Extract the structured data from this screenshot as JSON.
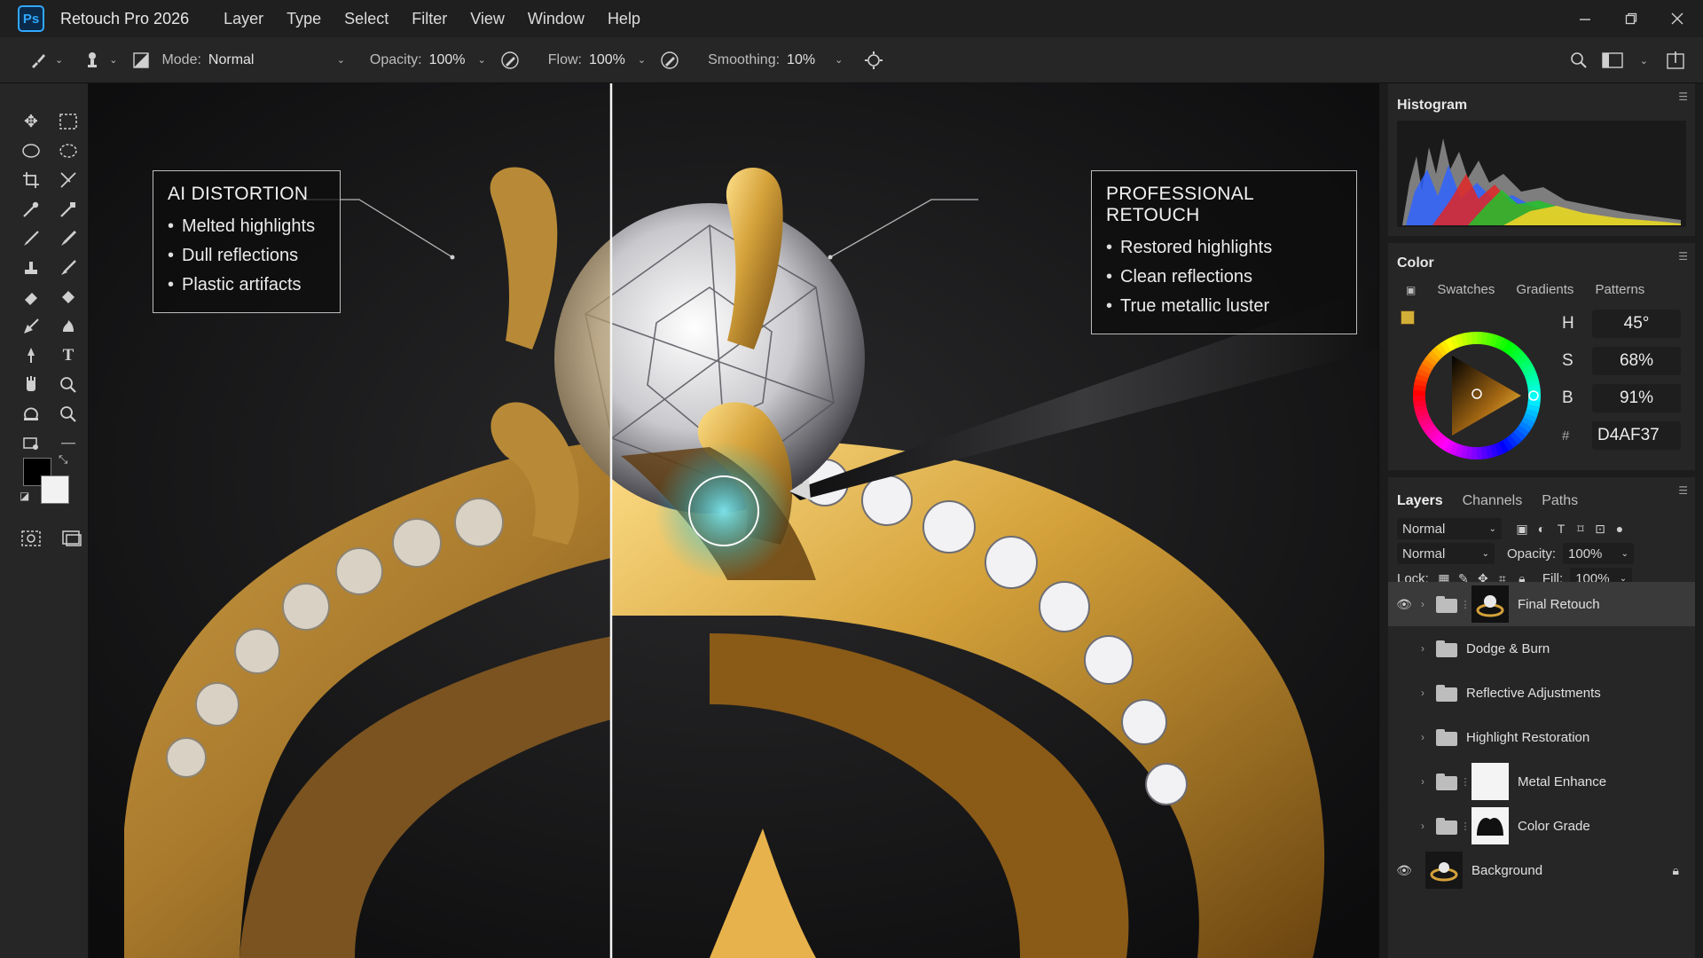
{
  "app": {
    "logo": "Ps",
    "title": "Retouch Pro 2026",
    "menu": [
      "Layer",
      "Type",
      "Select",
      "Filter",
      "View",
      "Window",
      "Help"
    ],
    "window_controls": [
      "minimize-icon",
      "restore-icon",
      "close-icon"
    ]
  },
  "options": {
    "mode_label": "Mode:",
    "mode_value": "Normal",
    "opacity_label": "Opacity:",
    "opacity_value": "100%",
    "flow_label": "Flow:",
    "flow_value": "100%",
    "smoothing_label": "Smoothing:",
    "smoothing_value": "10%"
  },
  "toolbar": {
    "tools": [
      "move-icon",
      "marquee-icon",
      "lasso-icon",
      "quick-select-icon",
      "crop-icon",
      "frame-icon",
      "eyedropper-icon",
      "patch-icon",
      "brush-icon",
      "healing-icon",
      "clone-stamp-icon",
      "history-brush-icon",
      "eraser-icon",
      "paint-bucket-icon",
      "pen-icon",
      "burn-icon",
      "path-select-icon",
      "type-icon",
      "hand-icon",
      "zoom-icon",
      "rotate-view-icon",
      "zoom-icon"
    ],
    "foreground_color": "#000000",
    "background_color": "#f2f2f2"
  },
  "canvas": {
    "left_callout": {
      "title": "AI DISTORTION",
      "items": [
        "Melted highlights",
        "Dull reflections",
        "Plastic artifacts"
      ]
    },
    "right_callout": {
      "title": "PROFESSIONAL RETOUCH",
      "items": [
        "Restored highlights",
        "Clean reflections",
        "True metallic luster"
      ]
    },
    "split_position": 0.405,
    "gold_color": "#D4AF37",
    "brush_glow_color": "#5fe3f0"
  },
  "histogram": {
    "title": "Histogram"
  },
  "color": {
    "title": "Color",
    "tabs": [
      "Swatches",
      "Gradients",
      "Patterns"
    ],
    "h_label": "H",
    "h_value": "45°",
    "s_label": "S",
    "s_value": "68%",
    "b_label": "B",
    "b_value": "91%",
    "hex_label": "#",
    "hex_value": "D4AF37",
    "current_color": "#D4AF37"
  },
  "layers": {
    "tabs": [
      "Layers",
      "Channels",
      "Paths"
    ],
    "filter_value": "Normal",
    "blend_value": "Normal",
    "opacity_label": "Opacity:",
    "opacity_value": "100%",
    "lock_label": "Lock:",
    "fill_label": "Fill:",
    "fill_value": "100%",
    "items": [
      {
        "name": "Final Retouch",
        "visible": true,
        "selected": true
      },
      {
        "name": "Dodge & Burn"
      },
      {
        "name": "Reflective Adjustments"
      },
      {
        "name": "Highlight Restoration"
      },
      {
        "name": "Metal Enhance"
      },
      {
        "name": "Color Grade"
      },
      {
        "name": "Background",
        "visible": true,
        "locked": true
      }
    ]
  }
}
